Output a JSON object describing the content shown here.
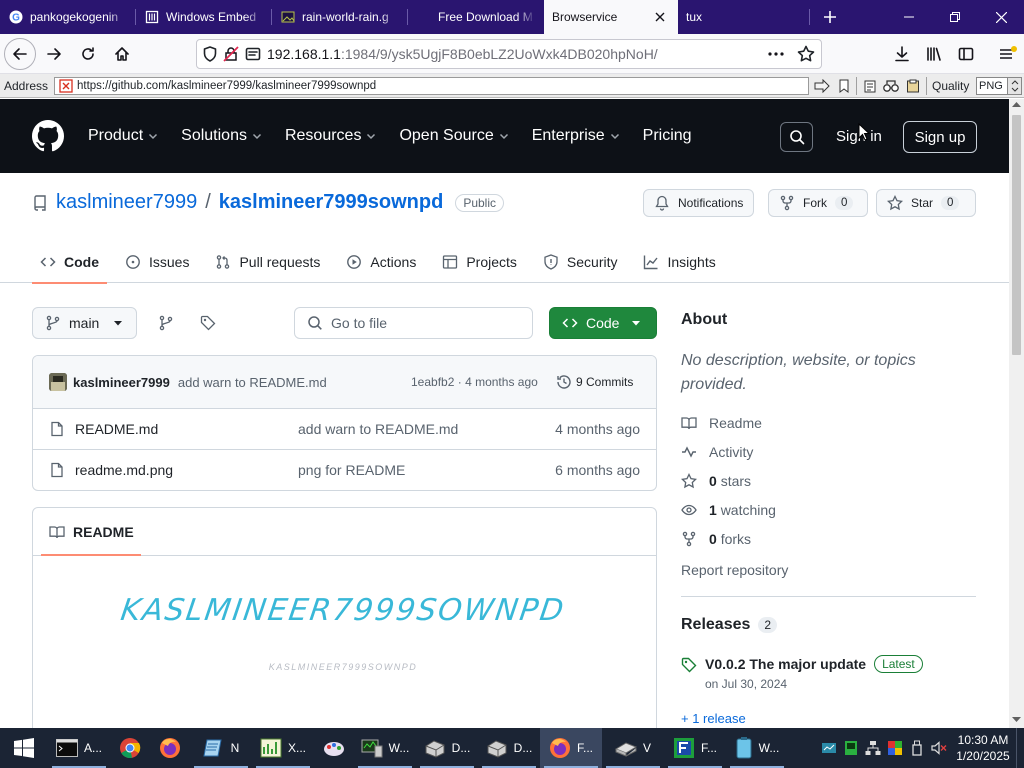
{
  "browser": {
    "tabs": [
      {
        "title": "pankogekogenin",
        "icon": "google-icon"
      },
      {
        "title": "Windows Embed",
        "icon": "page-icon"
      },
      {
        "title": "rain-world-rain.g",
        "icon": "image-icon"
      },
      {
        "title": "Free Download M",
        "icon": "none"
      },
      {
        "title": "Browservice",
        "icon": "none",
        "active": true
      },
      {
        "title": "tux",
        "icon": "none"
      }
    ],
    "url_host": "192.168.1.1",
    "url_path": ":1984/9/ysk5UgjF8B0ebLZ2UoWxk4DB020hpNoH/",
    "address_label": "Address",
    "address_value": "https://github.com/kaslmineer7999/kaslmineer7999sownpd",
    "quality_label": "Quality",
    "quality_value": "PNG"
  },
  "github": {
    "nav": [
      "Product",
      "Solutions",
      "Resources",
      "Open Source",
      "Enterprise",
      "Pricing"
    ],
    "sign_in": "Sign in",
    "sign_up": "Sign up",
    "owner": "kaslmineer7999",
    "slash": "/",
    "repo": "kaslmineer7999sownpd",
    "visibility": "Public",
    "notifications": "Notifications",
    "fork_label": "Fork",
    "fork_count": "0",
    "star_label": "Star",
    "star_count": "0",
    "tabs": [
      "Code",
      "Issues",
      "Pull requests",
      "Actions",
      "Projects",
      "Security",
      "Insights"
    ],
    "branch": "main",
    "go_to_file": "Go to file",
    "code_button": "Code",
    "commit": {
      "author": "kaslmineer7999",
      "message": "add warn to README.md",
      "hash": "1eabfb2",
      "sep": "·",
      "age": "4 months ago",
      "commits": "9 Commits"
    },
    "files": [
      {
        "name": "README.md",
        "message": "add warn to README.md",
        "age": "4 months ago"
      },
      {
        "name": "readme.md.png",
        "message": "png for README",
        "age": "6 months ago"
      }
    ],
    "readme_tab": "README",
    "readme_banner": "KASLMINEER7999SOWNPD",
    "readme_subtext": "KASLMINEER7999SOWNPD",
    "about": {
      "title": "About",
      "description": "No description, website, or topics provided.",
      "readme": "Readme",
      "activity": "Activity",
      "stars_n": "0",
      "stars": "stars",
      "watching_n": "1",
      "watching": "watching",
      "forks_n": "0",
      "forks": "forks",
      "report": "Report repository"
    },
    "releases": {
      "title": "Releases",
      "count": "2",
      "latest_name": "V0.0.2 The major update",
      "latest_badge": "Latest",
      "latest_date": "on Jul 30, 2024",
      "more": "+ 1 release"
    }
  },
  "taskbar": {
    "items": [
      {
        "label": "A..."
      },
      {
        "label": ""
      },
      {
        "label": ""
      },
      {
        "label": "N"
      },
      {
        "label": "X..."
      },
      {
        "label": ""
      },
      {
        "label": "W..."
      },
      {
        "label": "D..."
      },
      {
        "label": "D..."
      },
      {
        "label": "F..."
      },
      {
        "label": "V"
      },
      {
        "label": "F..."
      },
      {
        "label": "W..."
      }
    ],
    "time": "10:30 AM",
    "date": "1/20/2025"
  },
  "colors": {
    "titlebar": "#2a1570",
    "github_header": "#0d1117",
    "code_button": "#1f883d",
    "link": "#0969da",
    "taskbar": "#1b2434"
  }
}
